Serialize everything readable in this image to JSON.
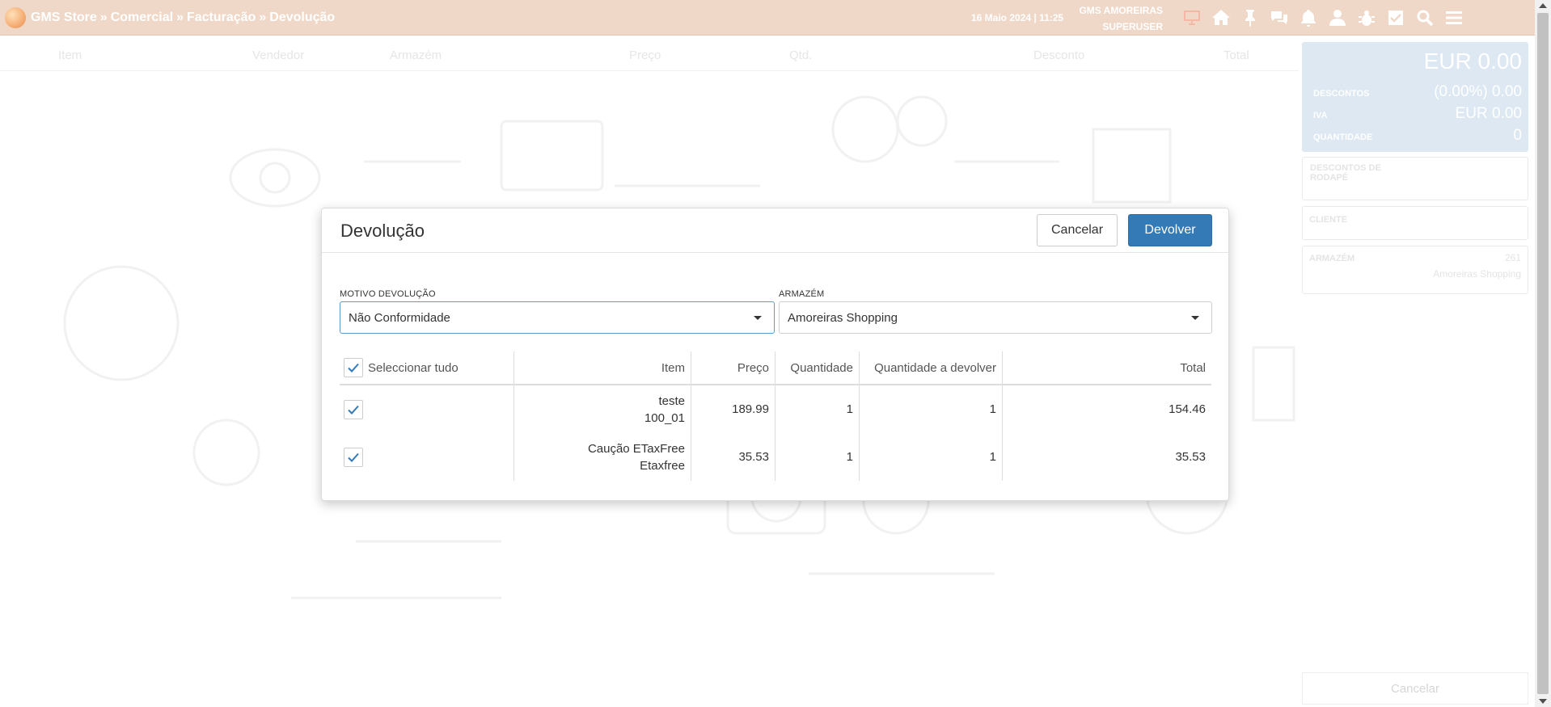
{
  "topbar": {
    "breadcrumb": [
      "GMS Store",
      "Comercial",
      "Facturação",
      "Devolução"
    ],
    "separator": "»",
    "datetime": "16 Maio 2024 | 11:25",
    "store": "GMS AMOREIRAS",
    "user": "SUPERUSER",
    "icons": [
      "monitor-icon",
      "home-icon",
      "pin-icon",
      "chat-icon",
      "bell-icon",
      "user-icon",
      "bug-icon",
      "check-square-icon",
      "search-icon",
      "menu-icon"
    ],
    "monitor_color": "#f4b9a6"
  },
  "grid": {
    "columns": [
      "Item",
      "Vendedor",
      "Armazém",
      "Preço",
      "Qtd.",
      "Desconto",
      "Total"
    ]
  },
  "summary": {
    "total": "EUR 0.00",
    "descontos_label": "DESCONTOS",
    "descontos_value": "(0.00%) 0.00",
    "iva_label": "IVA",
    "iva_value": "EUR 0.00",
    "quantidade_label": "QUANTIDADE",
    "quantidade_value": "0"
  },
  "rightpanel": {
    "footer_discounts": "DESCONTOS DE RODAPÉ",
    "cliente": "CLIENTE",
    "armazem_label": "ARMAZÉM",
    "armazem_code": "261",
    "armazem_name": "Amoreiras Shopping",
    "cancel": "Cancelar"
  },
  "modal": {
    "title": "Devolução",
    "cancel": "Cancelar",
    "confirm": "Devolver",
    "motivo_label": "MOTIVO DEVOLUÇÃO",
    "motivo_value": "Não Conformidade",
    "armazem_label": "ARMAZÉM",
    "armazem_value": "Amoreiras Shopping",
    "accent": "#337ab7",
    "table": {
      "select_all": "Seleccionar tudo",
      "headers": {
        "item": "Item",
        "preco": "Preço",
        "quantidade": "Quantidade",
        "qtd_devolver": "Quantidade a devolver",
        "total": "Total"
      },
      "rows": [
        {
          "item_line1": "teste",
          "item_line2": "100_01",
          "preco": "189.99",
          "quantidade": "1",
          "qtd_devolver": "1",
          "total": "154.46",
          "checked": true
        },
        {
          "item_line1": "Caução ETaxFree",
          "item_line2": "Etaxfree",
          "preco": "35.53",
          "quantidade": "1",
          "qtd_devolver": "1",
          "total": "35.53",
          "checked": true
        }
      ]
    }
  }
}
